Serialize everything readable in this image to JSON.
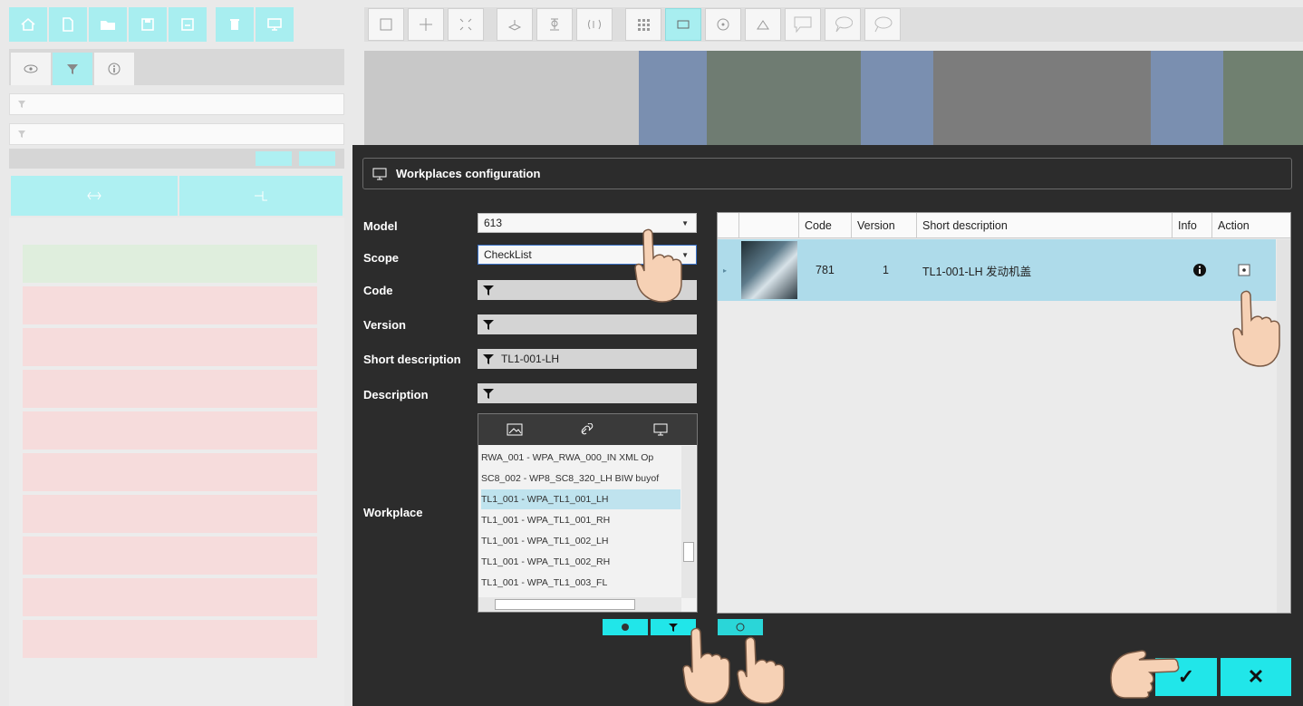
{
  "toolbar_left": {
    "buttons": [
      "home-icon",
      "new-document-icon",
      "open-icon",
      "save-icon",
      "save-as-icon",
      "delete-icon",
      "monitor-icon"
    ]
  },
  "toolbar_right": {
    "buttons": [
      "select-rect-icon",
      "move-icon",
      "fit-icon",
      "tool-a-icon",
      "tool-b-icon",
      "tool-c-icon",
      "grid-icon",
      "rectangle-icon",
      "circle-icon",
      "triangle-icon",
      "callout-rect-icon",
      "callout-round-icon",
      "callout-oval-icon"
    ]
  },
  "left_panel": {
    "tabs": [
      "eye-icon",
      "filter-icon",
      "info-icon"
    ]
  },
  "dialog": {
    "title": "Workplaces configuration",
    "labels": {
      "model": "Model",
      "scope": "Scope",
      "code": "Code",
      "version": "Version",
      "short_description": "Short description",
      "description": "Description",
      "workplace": "Workplace"
    },
    "values": {
      "model": "613",
      "scope": "CheckList",
      "code": "",
      "version": "",
      "short_description": "TL1-001-LH",
      "description": ""
    },
    "workplace_list": [
      "RWA_001 - WPA_RWA_000_IN XML Op",
      "SC8_002 - WP8_SC8_320_LH BIW buyof",
      "TL1_001 - WPA_TL1_001_LH",
      "TL1_001 - WPA_TL1_001_RH",
      "TL1_001 - WPA_TL1_002_LH",
      "TL1_001 - WPA_TL1_002_RH",
      "TL1_001 - WPA_TL1_003_FL"
    ],
    "workplace_selected_index": 2,
    "grid": {
      "columns": [
        "Code",
        "Version",
        "Short description",
        "Info",
        "Action"
      ],
      "rows": [
        {
          "code": "781",
          "version": "1",
          "short_description": "TL1-001-LH 发动机盖"
        }
      ]
    },
    "ok_label": "✓",
    "cancel_label": "✕"
  },
  "colors": {
    "accent": "#21e6e9",
    "dialog_bg": "#2c2c2c",
    "row_selected": "#aedbea"
  }
}
